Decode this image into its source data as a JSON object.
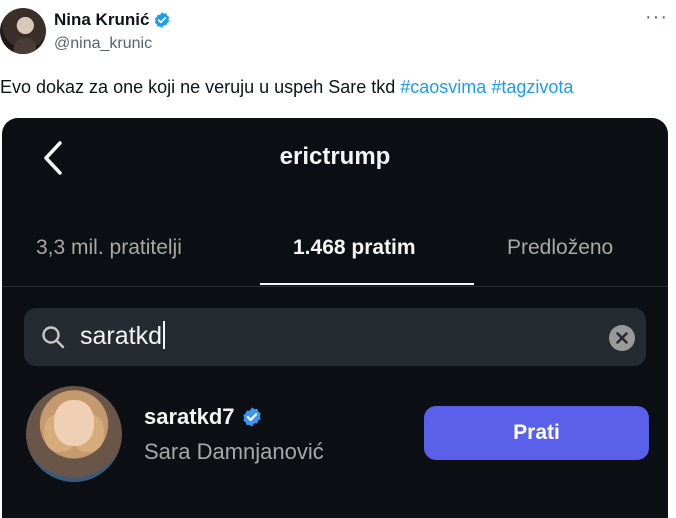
{
  "tweet": {
    "author_name": "Nina Krunić",
    "author_handle": "@nina_krunic",
    "more_label": "···",
    "text_main": "Evo dokaz za one koji ne veruju u uspeh Sare tkd ",
    "hashtags": [
      "#caosvima",
      "#tagzivota"
    ],
    "verified_color": "#1d9bf0"
  },
  "instagram": {
    "profile_title": "erictrump",
    "tabs": [
      {
        "label": "3,3 mil. pratitelji",
        "active": false
      },
      {
        "label": "1.468 pratim",
        "active": true
      },
      {
        "label": "Predloženo",
        "active": false
      }
    ],
    "search": {
      "value": "saratkd"
    },
    "result": {
      "username": "saratkd7",
      "full_name": "Sara Damnjanović",
      "follow_label": "Prati",
      "follow_color": "#5a60ea"
    },
    "background": "#0c0f14"
  }
}
